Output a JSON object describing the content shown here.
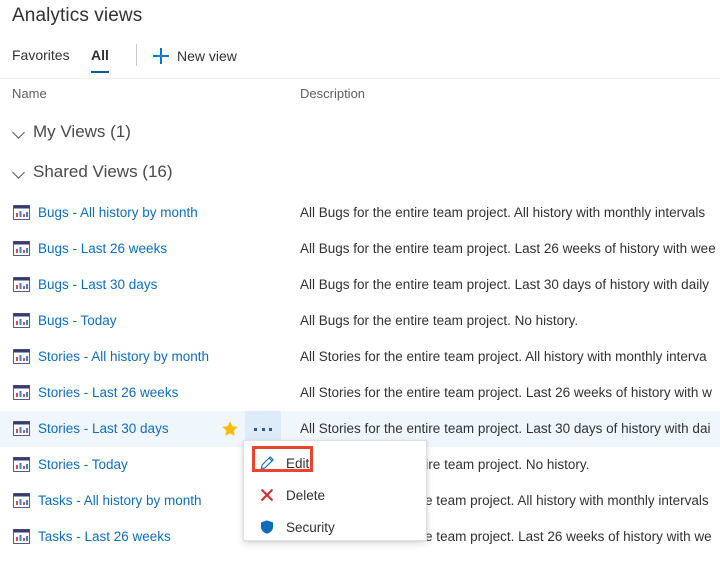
{
  "page": {
    "title": "Analytics views"
  },
  "tabs": [
    {
      "label": "Favorites",
      "active": false
    },
    {
      "label": "All",
      "active": true
    }
  ],
  "commands": {
    "new_view_label": "New view",
    "new_view_icon": "plus-icon"
  },
  "columns": {
    "name": "Name",
    "description": "Description"
  },
  "groups": [
    {
      "label": "My Views (1)",
      "expanded": true,
      "icon": "chevron-down-icon"
    },
    {
      "label": "Shared Views (16)",
      "expanded": true,
      "icon": "chevron-down-icon"
    }
  ],
  "rows": [
    {
      "name": "Bugs - All history by month",
      "description": "All Bugs for the entire team project. All history with monthly intervals",
      "selected": false
    },
    {
      "name": "Bugs - Last 26 weeks",
      "description": "All Bugs for the entire team project. Last 26 weeks of history with wee",
      "selected": false
    },
    {
      "name": "Bugs - Last 30 days",
      "description": "All Bugs for the entire team project. Last 30 days of history with daily",
      "selected": false
    },
    {
      "name": "Bugs - Today",
      "description": "All Bugs for the entire team project. No history.",
      "selected": false
    },
    {
      "name": "Stories - All history by month",
      "description": "All Stories for the entire team project. All history with monthly interva",
      "selected": false
    },
    {
      "name": "Stories - Last 26 weeks",
      "description": "All Stories for the entire team project. Last 26 weeks of history with w",
      "selected": false
    },
    {
      "name": "Stories - Last 30 days",
      "description": "All Stories for the entire team project. Last 30 days of history with dai",
      "selected": true
    },
    {
      "name": "Stories - Today",
      "description": "All Stories for the entire team project. No history.",
      "selected": false
    },
    {
      "name": "Tasks - All history by month",
      "description": "All Tasks for the entire team project. All history with monthly intervals",
      "selected": false
    },
    {
      "name": "Tasks - Last 26 weeks",
      "description": "All Tasks for the entire team project. Last 26 weeks of history with we",
      "selected": false
    }
  ],
  "selected_row_actions": {
    "favorite_icon": "star-icon",
    "more_icon": "ellipsis-icon"
  },
  "context_menu": {
    "items": [
      {
        "label": "Edit",
        "icon": "pencil-icon",
        "highlighted": true
      },
      {
        "label": "Delete",
        "icon": "x-icon",
        "highlighted": false
      },
      {
        "label": "Security",
        "icon": "shield-icon",
        "highlighted": false
      }
    ]
  },
  "colors": {
    "link": "#0f6cbd",
    "accent": "#0078d4",
    "tab_underline": "#0b5892",
    "selected_row_bg": "#eff6fc",
    "ellipsis_bg": "#deecf9",
    "star": "#ffb900",
    "delete_red": "#d13438",
    "shield_blue": "#0f6cbd",
    "highlight_box": "#e8452c"
  }
}
